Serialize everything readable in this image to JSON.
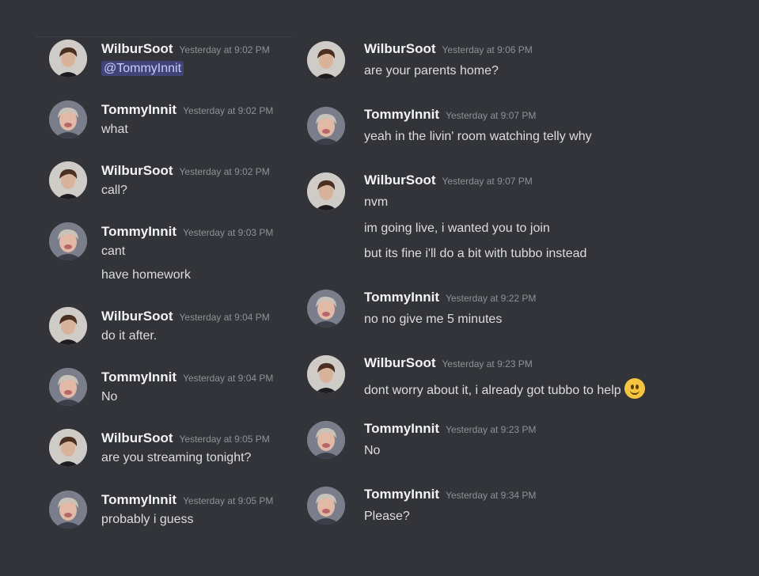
{
  "users": {
    "wilbur": "WilburSoot",
    "tommy": "TommyInnit"
  },
  "left": [
    {
      "author": "WilburSoot",
      "timestamp": "Yesterday at 9:02 PM",
      "lines": [],
      "mention": "@TommyInnit"
    },
    {
      "author": "TommyInnit",
      "timestamp": "Yesterday at 9:02 PM",
      "lines": [
        "what"
      ]
    },
    {
      "author": "WilburSoot",
      "timestamp": "Yesterday at 9:02 PM",
      "lines": [
        "call?"
      ]
    },
    {
      "author": "TommyInnit",
      "timestamp": "Yesterday at 9:03 PM",
      "lines": [
        "cant",
        "have homework"
      ]
    },
    {
      "author": "WilburSoot",
      "timestamp": "Yesterday at 9:04 PM",
      "lines": [
        "do it after."
      ]
    },
    {
      "author": "TommyInnit",
      "timestamp": "Yesterday at 9:04 PM",
      "lines": [
        "No"
      ]
    },
    {
      "author": "WilburSoot",
      "timestamp": "Yesterday at 9:05 PM",
      "lines": [
        "are you streaming tonight?"
      ]
    },
    {
      "author": "TommyInnit",
      "timestamp": "Yesterday at 9:05 PM",
      "lines": [
        "probably i guess"
      ]
    }
  ],
  "right": [
    {
      "author": "WilburSoot",
      "timestamp": "Yesterday at 9:06 PM",
      "lines": [
        "are your parents home?"
      ]
    },
    {
      "author": "TommyInnit",
      "timestamp": "Yesterday at 9:07 PM",
      "lines": [
        "yeah in the livin' room watching telly why"
      ]
    },
    {
      "author": "WilburSoot",
      "timestamp": "Yesterday at 9:07 PM",
      "lines": [
        "nvm",
        "im going live, i wanted you to join",
        "but its fine i'll do a bit with tubbo instead"
      ]
    },
    {
      "author": "TommyInnit",
      "timestamp": "Yesterday at 9:22 PM",
      "lines": [
        "no no give me 5 minutes"
      ]
    },
    {
      "author": "WilburSoot",
      "timestamp": "Yesterday at 9:23 PM",
      "lines": [
        "dont worry about it, i already got tubbo to help"
      ],
      "emoji": "slight-smile-emoji"
    },
    {
      "author": "TommyInnit",
      "timestamp": "Yesterday at 9:23 PM",
      "lines": [
        "No"
      ]
    },
    {
      "author": "TommyInnit",
      "timestamp": "Yesterday at 9:34 PM",
      "lines": [
        "Please?"
      ]
    }
  ],
  "colors": {
    "background": "#333439",
    "username": "#f2f3f5",
    "text": "#dcddde",
    "timestamp": "#8e9297",
    "mention_bg": "#4d5290"
  }
}
